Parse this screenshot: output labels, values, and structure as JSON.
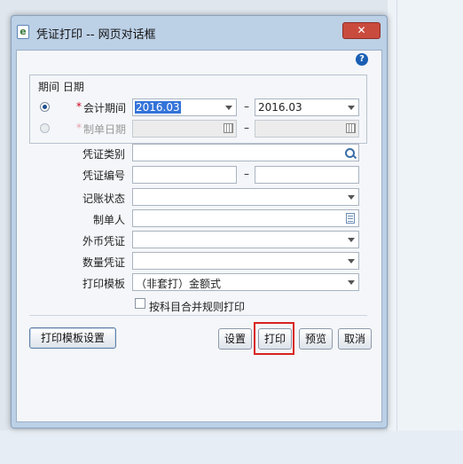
{
  "dialog": {
    "title": "凭证打印 -- 网页对话框",
    "close_label": "✕",
    "help_label": "?"
  },
  "period": {
    "legend": "期间 日期",
    "accounting_period": {
      "label": "会计期间",
      "required": "*",
      "from": "2016.03",
      "dash": "–",
      "to": "2016.03",
      "selected": true
    },
    "creation_date": {
      "label": "制单日期",
      "required": "*",
      "from": "",
      "dash": "–",
      "to": "",
      "selected": false
    }
  },
  "form": {
    "voucher_type": {
      "label": "凭证类别",
      "value": ""
    },
    "voucher_number": {
      "label": "凭证编号",
      "from": "",
      "dash": "–",
      "to": ""
    },
    "posting_status": {
      "label": "记账状态",
      "value": ""
    },
    "preparer": {
      "label": "制单人",
      "value": ""
    },
    "foreign_voucher": {
      "label": "外币凭证",
      "value": ""
    },
    "quantity_voucher": {
      "label": "数量凭证",
      "value": ""
    },
    "print_template": {
      "label": "打印模板",
      "value": "（非套打）金额式"
    },
    "merge_checkbox": {
      "label": "按科目合并规则打印",
      "checked": false
    }
  },
  "buttons": {
    "template_settings": "打印模板设置",
    "settings": "设置",
    "print": "打印",
    "preview": "预览",
    "cancel": "取消"
  },
  "colors": {
    "highlight": "#d8231f",
    "selection": "#3473d9",
    "required": "#d0021b"
  }
}
